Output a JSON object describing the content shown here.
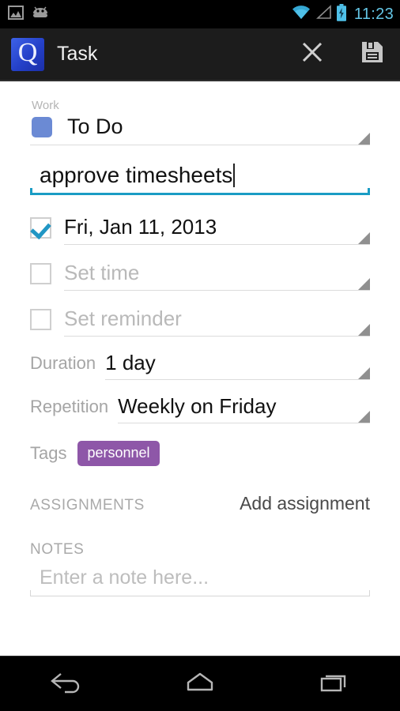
{
  "status_bar": {
    "left_icons": [
      "screenshot-image-icon",
      "android-robot-icon"
    ],
    "right_icons": [
      "wifi-icon",
      "cell-signal-icon",
      "battery-charging-icon"
    ],
    "clock": "11:23",
    "accent_color": "#64c6e6"
  },
  "action_bar": {
    "logo_letter": "Q",
    "title": "Task",
    "close_label": "close-icon",
    "save_label": "save-icon"
  },
  "form": {
    "category_group_label": "Work",
    "category_value": "To Do",
    "category_color": "#6b8ad4",
    "title_value": "approve timesheets",
    "title_underline_color": "#1a9cc4",
    "due_date": {
      "label": "Fri, Jan 11, 2013",
      "checked": true
    },
    "set_time": {
      "label": "Set time",
      "checked": false
    },
    "set_reminder": {
      "label": "Set reminder",
      "checked": false
    },
    "duration": {
      "label": "Duration",
      "value": "1 day"
    },
    "repetition": {
      "label": "Repetition",
      "value": "Weekly on Friday"
    },
    "tags": {
      "label": "Tags",
      "chips": [
        {
          "text": "personnel",
          "color": "#8e57a8"
        }
      ]
    },
    "assignments": {
      "title": "ASSIGNMENTS",
      "action": "Add assignment"
    },
    "notes": {
      "title": "NOTES",
      "placeholder": "Enter a note here...",
      "value": ""
    }
  },
  "nav_bar": {
    "back": "back-icon",
    "home": "home-icon",
    "recents": "recents-icon"
  }
}
